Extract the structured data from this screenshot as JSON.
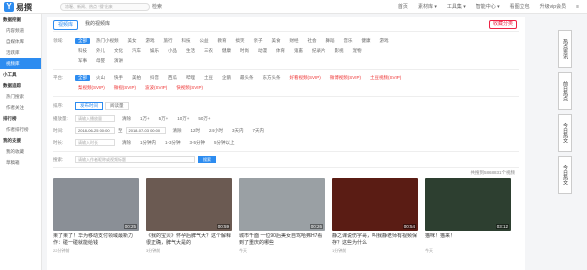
{
  "header": {
    "logo": "易撰",
    "search_placeholder": "凉喔、新闻、热点 “搜”出来",
    "search_btn": "检索",
    "nav": [
      "首页",
      "素材库 ▾",
      "工具集 ▾",
      "智能中心 ▾",
      "看图立包",
      "升级vip会员",
      "≡"
    ]
  },
  "sidebar": {
    "items": [
      {
        "label": "数据挖掘",
        "head": true
      },
      {
        "label": "内容频道",
        "head": false
      },
      {
        "label": "自媒体库",
        "head": false
      },
      {
        "label": "活跃库",
        "head": false
      },
      {
        "label": "视频库",
        "head": false,
        "active": true
      },
      {
        "label": "小工具",
        "head": true
      },
      {
        "label": "数据追踪",
        "head": true
      },
      {
        "label": "热门搜索",
        "head": false
      },
      {
        "label": "作者关注",
        "head": false
      },
      {
        "label": "排行榜",
        "head": true
      },
      {
        "label": "作者排行榜",
        "head": false
      },
      {
        "label": "我的支援",
        "head": true
      },
      {
        "label": "我的收藏",
        "head": false
      },
      {
        "label": "草稿箱",
        "head": false
      }
    ]
  },
  "tabs": [
    "视频库",
    "我的视频库"
  ],
  "collect_label": "收藏分类",
  "filters": {
    "field_label": "领域:",
    "field_row1": [
      "全部",
      "热门小视频",
      "美女",
      "游戏",
      "旅行",
      "科技",
      "公益",
      "教育",
      "搞笑",
      "亲子",
      "美食",
      "财经",
      "社会",
      "舞蹈",
      "音乐",
      "健康",
      "游戏"
    ],
    "field_row2": [
      "科技",
      "外儿",
      "文化",
      "汽车",
      "娱乐",
      "小品",
      "生活",
      "三农",
      "健康",
      "时尚",
      "动漫",
      "体育",
      "鬼畜",
      "纪录片",
      "影视",
      "宠物"
    ],
    "field_row3": [
      "军事",
      "母婴",
      "演讲"
    ],
    "platform_label": "平台:",
    "platform_row1": [
      "全部",
      "火山",
      "快手",
      "美拍",
      "抖音",
      "西瓜",
      "哔哩",
      "土豆",
      "企鹅",
      "最头条",
      "东方头条",
      "好看视频(SVIP)",
      "微博视频(SVIP)",
      "土豆视频(SVIP)"
    ],
    "platform_row2": [
      "梨视频(SVIP)",
      "微视(SVIP)",
      "波波(SVIP)",
      "快视频(SVIP)"
    ],
    "sort_label": "排序:",
    "sort": [
      "发布时间",
      "阅读量"
    ],
    "plays_label": "播放量:",
    "plays_placeholder": "请输入播放量",
    "plays": [
      "清除",
      "1万+",
      "5万+",
      "10万+",
      "50万+"
    ],
    "time_label": "时间:",
    "time_start": "2018-06-25 00:00",
    "time_to": "至",
    "time_end": "2018-07-03 00:00",
    "time_opts": [
      "清除",
      "12时",
      "24小时",
      "3天内",
      "7天内"
    ],
    "dur_label": "时长:",
    "dur_placeholder": "请输入时长",
    "dur_opts": [
      "清除",
      "1分钟内",
      "1-3分钟",
      "3-5分钟",
      "5分钟以上"
    ],
    "search_label": "搜索:",
    "search_placeholder": "请输入作者昵称或视频标题",
    "search_btn": "搜索"
  },
  "total": "共搜到5868831个视频",
  "cards": [
    {
      "title": "果了果了！华为移动支付领域最新力作：碰一碰就能给钱",
      "duration": "00:25",
      "meta": "22分钟前",
      "color": "#8a8f96"
    },
    {
      "title": "《我的宝贝》怀孕后脾气大？这个解释很正确，脾气大是的",
      "duration": "00:59",
      "meta": "3分钟前",
      "color": "#6b5a52"
    },
    {
      "title": "城市千面 一位90后美女自驾哈弗H7看到了重庆的哪些",
      "duration": "00:26",
      "meta": "今天",
      "color": "#9aa0a4"
    },
    {
      "title": "静之课说伤字哥，叫我静老师有视频保存？这些为什么",
      "duration": "00:54",
      "meta": "1分钟前",
      "color": "#5a1c14"
    },
    {
      "title": "猫咪！猫来！",
      "duration": "03:12",
      "meta": "今天",
      "color": "#2d3f30"
    }
  ],
  "side_panel": [
    "热点资讯",
    "前日热点",
    "今日热文",
    "今日热文"
  ]
}
